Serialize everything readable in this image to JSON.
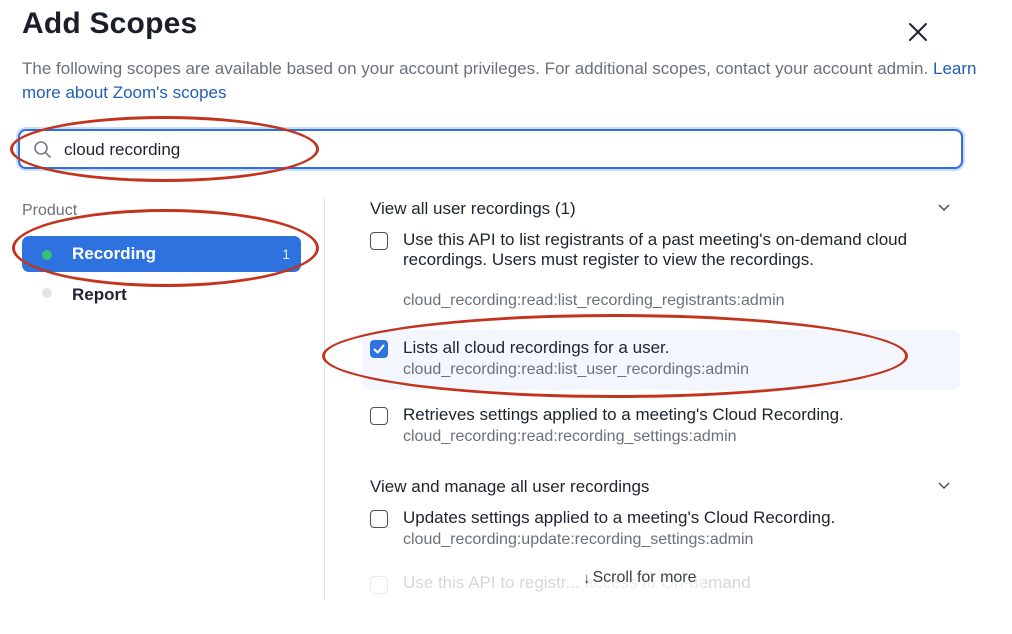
{
  "dialog": {
    "title": "Add Scopes",
    "description": "The following scopes are available based on your account privileges. For additional scopes, contact your account admin.",
    "learn_more_link": "Learn more about Zoom's scopes",
    "close_icon": "close-icon",
    "colors": {
      "accent": "#2e72df",
      "annotation": "#c2341d",
      "text_primary": "#1f2330",
      "text_secondary": "#6b707b"
    }
  },
  "search": {
    "value": "cloud recording",
    "icon": "search-icon"
  },
  "sidebar": {
    "label": "Product",
    "items": [
      {
        "label": "Recording",
        "count": "1",
        "active": true
      },
      {
        "label": "Report",
        "count": "",
        "active": false
      }
    ]
  },
  "scopes": {
    "sections": [
      {
        "title": "View all user recordings (1)",
        "items": [
          {
            "description": "Use this API to list registrants of a past meeting's on-demand cloud recordings. Users must register to view the recordings.",
            "scope": "cloud_recording:read:list_recording_registrants:admin",
            "checked": false
          },
          {
            "description": "Lists all cloud recordings for a user.",
            "scope": "cloud_recording:read:list_user_recordings:admin",
            "checked": true
          },
          {
            "description": "Retrieves settings applied to a meeting's Cloud Recording.",
            "scope": "cloud_recording:read:recording_settings:admin",
            "checked": false
          }
        ]
      },
      {
        "title": "View and manage all user recordings",
        "items": [
          {
            "description": "Updates settings applied to a meeting's Cloud Recording.",
            "scope": "cloud_recording:update:recording_settings:admin",
            "checked": false
          },
          {
            "description": "Use this API to registr... access to On-demand",
            "scope": "",
            "checked": false
          }
        ]
      }
    ]
  },
  "footer": {
    "scroll_more": "Scroll for more",
    "arrow_icon": "arrow-down-icon"
  }
}
